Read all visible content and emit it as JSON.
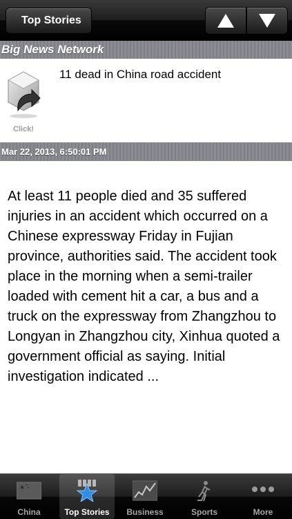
{
  "navbar": {
    "back_label": "Top Stories",
    "prev_icon": "arrow-up-icon",
    "next_icon": "arrow-down-icon"
  },
  "source": {
    "name": "Big News Network"
  },
  "story": {
    "thumbnail_icon": "external-link-icon",
    "thumbnail_label": "Click!",
    "headline": "11 dead in China road accident",
    "timestamp": "Mar 22, 2013, 6:50:01 PM",
    "body": "At least 11 people died and 35 suffered injuries in an accident which occurred on a Chinese expressway Friday in Fujian province, authorities said. The accident took place in the morning when a semi-trailer loaded with cement hit a car, a bus and a truck on the expressway from Zhangzhou to Longyan in Zhangzhou city, Xinhua quoted a government official as saying. Initial investigation indicated ..."
  },
  "tabbar": {
    "tabs": [
      {
        "label": "China",
        "icon": "china-flag-icon",
        "active": false
      },
      {
        "label": "Top Stories",
        "icon": "star-icon",
        "active": true
      },
      {
        "label": "Business",
        "icon": "stock-chart-icon",
        "active": false
      },
      {
        "label": "Sports",
        "icon": "hockey-player-icon",
        "active": false
      },
      {
        "label": "More",
        "icon": "more-dots-icon",
        "active": false
      }
    ]
  },
  "colors": {
    "accent": "#2f8fe8",
    "section_bar": "#85858c"
  }
}
